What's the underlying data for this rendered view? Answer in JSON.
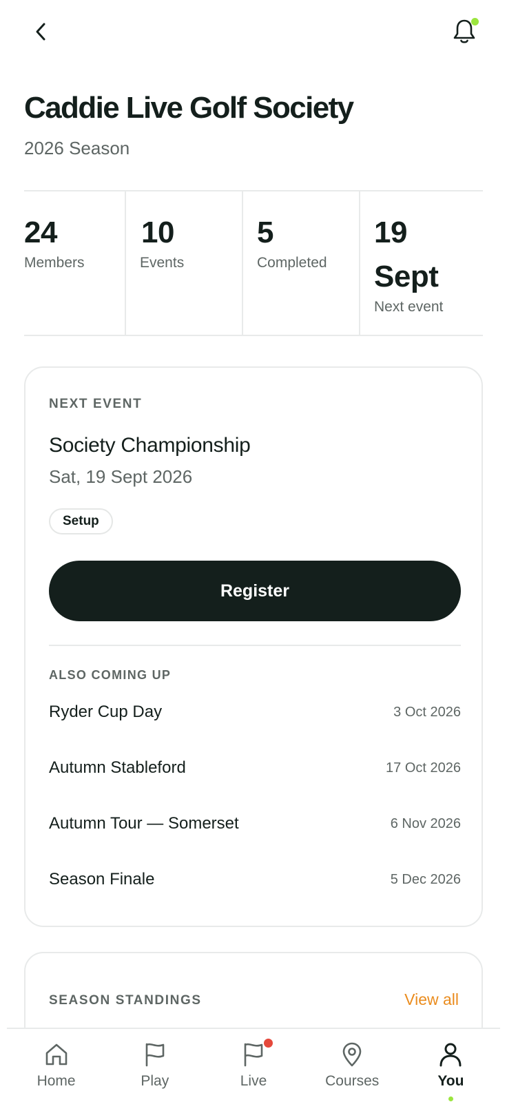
{
  "header": {
    "back_icon": "chevron-left-icon",
    "bell_icon": "bell-icon",
    "notification_dot_color": "#9be53e"
  },
  "society": {
    "title": "Caddie Live Golf Society",
    "season": "2026 Season"
  },
  "stats": [
    {
      "value": "24",
      "label": "Members"
    },
    {
      "value": "10",
      "label": "Events"
    },
    {
      "value": "5",
      "label": "Completed"
    },
    {
      "value": "19\nSept",
      "label": "Next event"
    }
  ],
  "next_event": {
    "eyebrow": "NEXT EVENT",
    "name": "Society Championship",
    "date": "Sat, 19 Sept 2026",
    "status_chip": "Setup",
    "register_label": "Register",
    "also_coming_up_label": "ALSO COMING UP",
    "upcoming": [
      {
        "name": "Ryder Cup Day",
        "date": "3 Oct 2026"
      },
      {
        "name": "Autumn Stableford",
        "date": "17 Oct 2026"
      },
      {
        "name": "Autumn Tour — Somerset",
        "date": "6 Nov 2026"
      },
      {
        "name": "Season Finale",
        "date": "5 Dec 2026"
      }
    ]
  },
  "standings": {
    "eyebrow": "SEASON STANDINGS",
    "view_all_label": "View all",
    "view_all_color": "#ea8c1e"
  },
  "bottom_nav": {
    "items": [
      {
        "label": "Home",
        "icon": "home-icon"
      },
      {
        "label": "Play",
        "icon": "flag-icon"
      },
      {
        "label": "Live",
        "icon": "live-flag-icon"
      },
      {
        "label": "Courses",
        "icon": "map-pin-icon"
      },
      {
        "label": "You",
        "icon": "user-icon"
      }
    ],
    "active": "You",
    "live_badge_color": "#e5483b",
    "active_dot_color": "#9be53e"
  },
  "colors": {
    "primary_dark": "#141f1c",
    "muted_text": "#5e6664",
    "border": "#e8eaea"
  }
}
